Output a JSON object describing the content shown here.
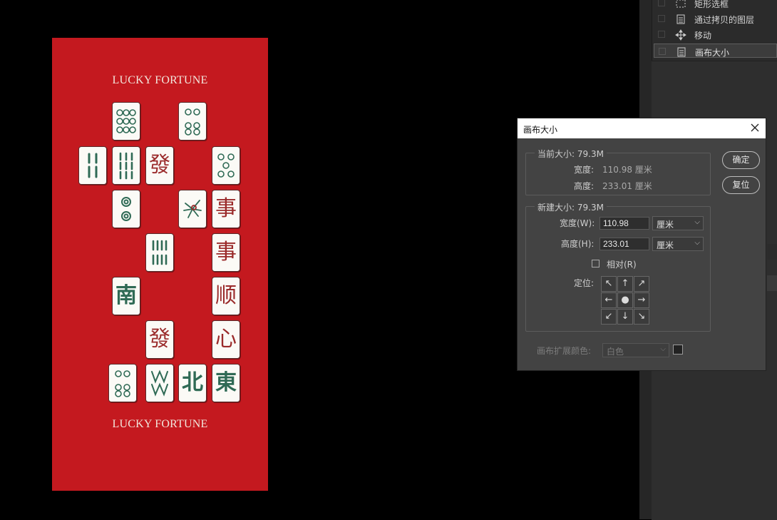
{
  "artwork": {
    "title_top": "LUCKY FORTUNE",
    "title_bottom": "LUCKY FORTUNE",
    "tiles": {
      "fa1": "發",
      "fa2": "發",
      "shi1": "事",
      "shi2": "事",
      "shun": "顺",
      "xin": "心",
      "nan": "南",
      "bei": "北",
      "dong": "東"
    }
  },
  "history": {
    "items": [
      {
        "label": "矩形选框",
        "icon": "marquee-icon"
      },
      {
        "label": "通过拷贝的图层",
        "icon": "document-icon"
      },
      {
        "label": "移动",
        "icon": "move-icon"
      },
      {
        "label": "画布大小",
        "icon": "document-icon",
        "selected": true
      }
    ]
  },
  "dialog": {
    "title": "画布大小",
    "current": {
      "group_label": "当前大小: 79.3M",
      "width_label": "宽度:",
      "width_value": "110.98 厘米",
      "height_label": "高度:",
      "height_value": "233.01 厘米"
    },
    "new": {
      "group_label": "新建大小: 79.3M",
      "width_label": "宽度(W):",
      "width_value": "110.98",
      "width_unit": "厘米",
      "height_label": "高度(H):",
      "height_value": "233.01",
      "height_unit": "厘米",
      "relative_label": "相对(R)",
      "relative_checked": false,
      "anchor_label": "定位:",
      "anchor_glyphs": [
        "↖",
        "↑",
        "↗",
        "←",
        "●",
        "→",
        "↙",
        "↓",
        "↘"
      ]
    },
    "ext_color_label": "画布扩展颜色:",
    "ext_color_value": "白色",
    "ok_label": "确定",
    "reset_label": "复位"
  },
  "colors": {
    "canvas_red": "#c4191f",
    "tile_face": "#fbfaf6",
    "tile_green": "#2f6a55",
    "tile_red": "#9a2a2a",
    "panel_bg": "#2b2b2b",
    "dialog_bg": "#434343"
  }
}
